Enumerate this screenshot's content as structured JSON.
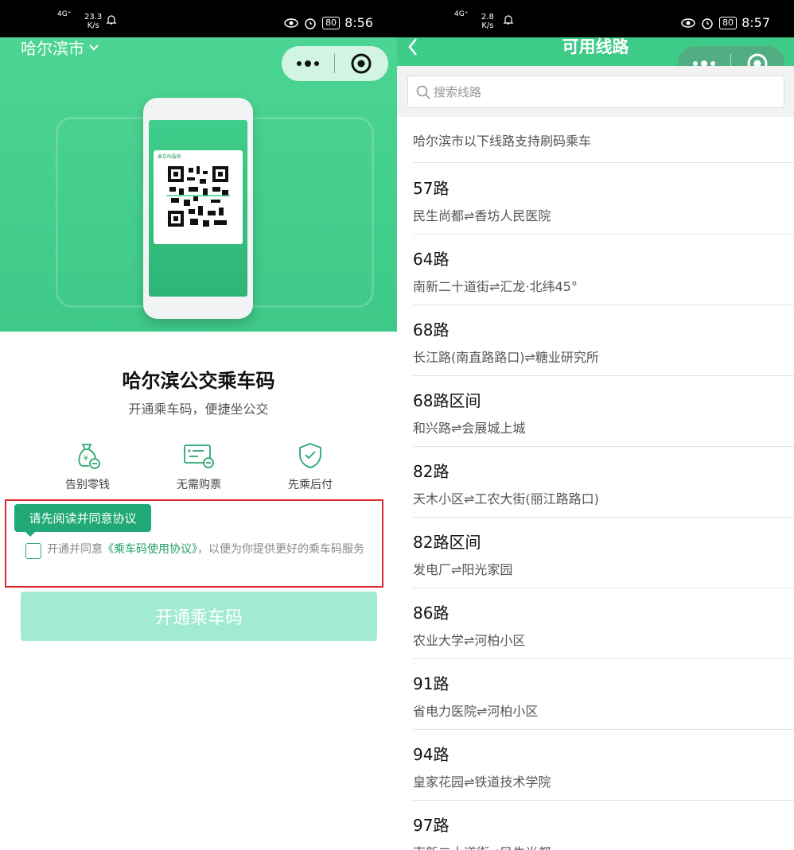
{
  "left": {
    "status": {
      "network": "4G⁺",
      "speed_value": "23.3",
      "speed_unit": "K/s",
      "battery": "80",
      "time": "8:56"
    },
    "city": "哈尔滨市",
    "phone_card_title": "乘车码服务",
    "title": "哈尔滨公交乘车码",
    "subtitle": "开通乘车码，便捷坐公交",
    "features": [
      {
        "label": "告别零钱",
        "icon": "money-bag-icon"
      },
      {
        "label": "无需购票",
        "icon": "card-icon"
      },
      {
        "label": "先乘后付",
        "icon": "shield-check-icon"
      }
    ],
    "tooltip": "请先阅读并同意协议",
    "agree": {
      "prefix": "开通并同意",
      "link": "《乘车码使用协议》",
      "suffix": "，以便为你提供更好的乘车码服务"
    },
    "open_button": "开通乘车码",
    "colors": {
      "primary": "#3ecb87",
      "highlight_border": "#d9292d",
      "button_disabled": "#a0ebd1"
    }
  },
  "right": {
    "status": {
      "network": "4G⁺",
      "speed_value": "2.8",
      "speed_unit": "K/s",
      "battery": "80",
      "time": "8:57"
    },
    "title": "可用线路",
    "search_placeholder": "搜索线路",
    "list_header": "哈尔滨市以下线路支持刷码乘车",
    "routes": [
      {
        "name": "57路",
        "desc": "民生尚都⇌香坊人民医院"
      },
      {
        "name": "64路",
        "desc": "南新二十道街⇌汇龙·北纬45°"
      },
      {
        "name": "68路",
        "desc": "长江路(南直路路口)⇌糖业研究所"
      },
      {
        "name": "68路区间",
        "desc": "和兴路⇌会展城上城"
      },
      {
        "name": "82路",
        "desc": "天木小区⇌工农大街(丽江路路口)"
      },
      {
        "name": "82路区间",
        "desc": "发电厂⇌阳光家园"
      },
      {
        "name": "86路",
        "desc": "农业大学⇌河柏小区"
      },
      {
        "name": "91路",
        "desc": "省电力医院⇌河柏小区"
      },
      {
        "name": "94路",
        "desc": "皇家花园⇌铁道技术学院"
      },
      {
        "name": "97路",
        "desc": "南新二十道街⇌民生尚都"
      }
    ]
  }
}
